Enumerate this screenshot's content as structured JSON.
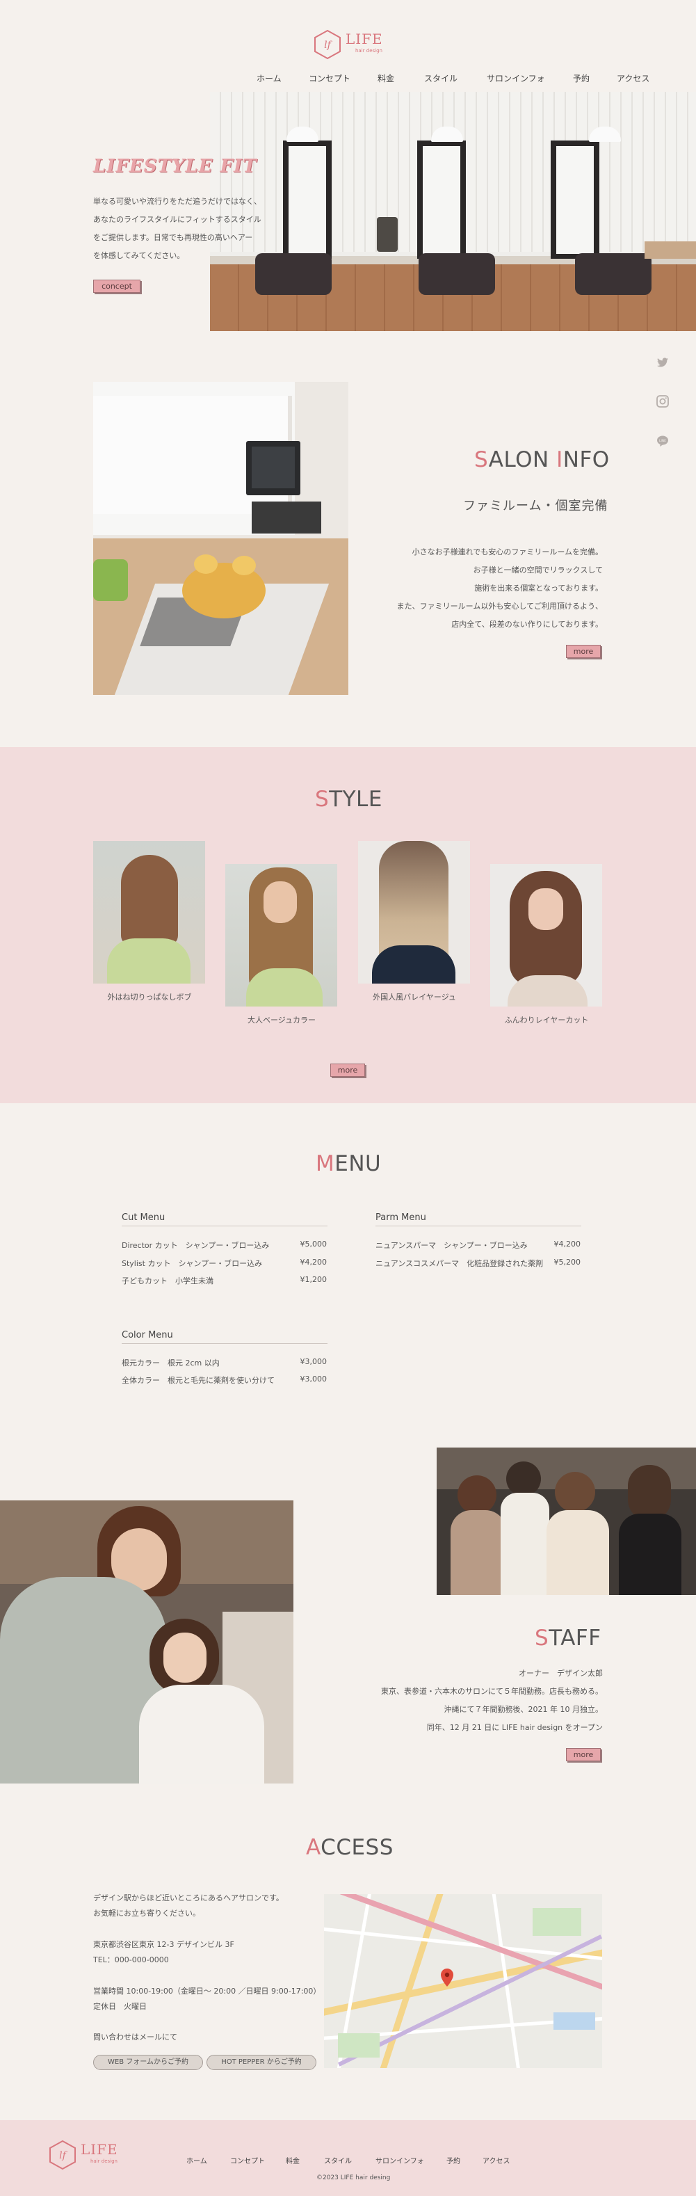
{
  "brand": {
    "name": "LIFE",
    "sub": "hair design"
  },
  "nav": [
    "ホーム",
    "コンセプト",
    "料金",
    "スタイル",
    "サロンインフォ",
    "予約",
    "アクセス"
  ],
  "hero": {
    "title": "LIFESTYLE FIT",
    "lines": [
      "単なる可愛いや流行りをただ追うだけではなく、",
      "あなたのライフスタイルにフィットするスタイル",
      "をご提供します。日常でも再現性の高いヘアー",
      "を体感してみてください。"
    ],
    "button": "concept"
  },
  "social_icons": [
    "twitter-icon",
    "instagram-icon",
    "line-icon"
  ],
  "salon": {
    "title_initial": "S",
    "title_rest": "ALON ",
    "title_initial2": "I",
    "title_rest2": "NFO",
    "subtitle": "ファミルーム・個室完備",
    "lines": [
      "小さなお子様連れでも安心のファミリールームを完備。",
      "お子様と一緒の空間でリラックスして",
      "施術を出来る個室となっております。",
      "また、ファミリールーム以外も安心してご利用頂けるよう、",
      "店内全て、段差のない作りにしております。"
    ],
    "button": "more"
  },
  "style": {
    "title_initial": "S",
    "title_rest": "TYLE",
    "items": [
      "外はね切りっぱなしボブ",
      "大人ベージュカラー",
      "外国人風バレイヤージュ",
      "ふんわりレイヤーカット"
    ],
    "button": "more"
  },
  "menu": {
    "title_initial": "M",
    "title_rest": "ENU",
    "cut": {
      "heading": "Cut Menu",
      "rows": [
        {
          "name": "Director カット　シャンプー・ブロー込み",
          "price": "¥5,000"
        },
        {
          "name": "Stylist カット　シャンプー・ブロー込み",
          "price": "¥4,200"
        },
        {
          "name": "子どもカット　小学生未満",
          "price": "¥1,200"
        }
      ]
    },
    "parm": {
      "heading": "Parm Menu",
      "rows": [
        {
          "name": "ニュアンスパーマ　シャンプー・ブロー込み",
          "price": "¥4,200"
        },
        {
          "name": "ニュアンスコスメパーマ　化粧品登録された薬剤",
          "price": "¥5,200"
        }
      ]
    },
    "color": {
      "heading": "Color Menu",
      "rows": [
        {
          "name": "根元カラー　根元 2cm 以内",
          "price": "¥3,000"
        },
        {
          "name": "全体カラー　根元と毛先に薬剤を使い分けて",
          "price": "¥3,000"
        }
      ]
    }
  },
  "staff": {
    "title_initial": "S",
    "title_rest": "TAFF",
    "lines": [
      "オーナー　デザイン太郎",
      "東京、表参道・六本木のサロンにて５年間勤務。店長も務める。",
      "沖縄にて７年間勤務後、2021 年 10 月独立。",
      "同年、12 月 21 日に LIFE hair design をオープン"
    ],
    "button": "more"
  },
  "access": {
    "title_initial": "A",
    "title_rest": "CCESS",
    "intro": [
      "デザイン駅からほど近いところにあるヘアサロンです。",
      "お気軽にお立ち寄りください。"
    ],
    "address": "東京都渋谷区東京 12-3 デザインビル 3F",
    "tel": "TEL：000-000-0000",
    "hours": "営業時間 10:00-19:00（金曜日〜 20:00 ／日曜日 9:00-17:00）",
    "holiday": "定休日　火曜日",
    "contact": "問い合わせはメールにて",
    "web_button": "WEB フォームからご予約",
    "hp_button": "HOT PEPPER からご予約"
  },
  "footer": {
    "nav": [
      "ホーム",
      "コンセプト",
      "料金",
      "スタイル",
      "サロンインフォ",
      "予約",
      "アクセス"
    ],
    "copyright": "©2023 LIFE hair desing"
  },
  "colors": {
    "accent": "#d9777e",
    "pink_bg": "#f2dcdc",
    "page_bg": "#f5f1ed",
    "button": "#e6a6aa"
  }
}
